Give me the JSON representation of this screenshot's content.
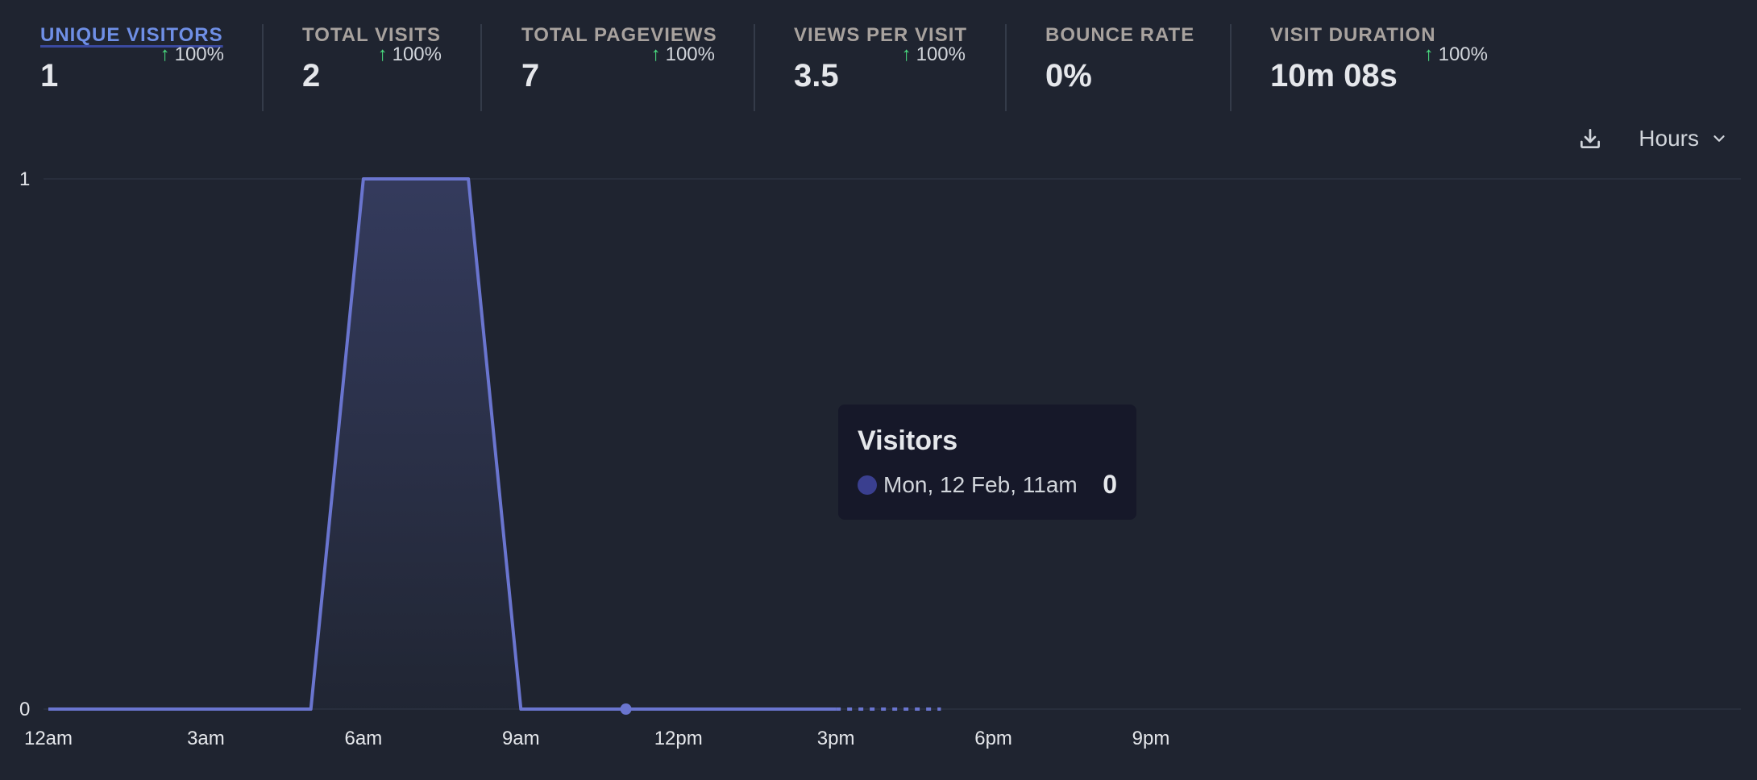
{
  "stats": [
    {
      "label": "UNIQUE VISITORS",
      "value": "1",
      "change": "100%",
      "active": true
    },
    {
      "label": "TOTAL VISITS",
      "value": "2",
      "change": "100%",
      "active": false
    },
    {
      "label": "TOTAL PAGEVIEWS",
      "value": "7",
      "change": "100%",
      "active": false
    },
    {
      "label": "VIEWS PER VISIT",
      "value": "3.5",
      "change": "100%",
      "active": false
    },
    {
      "label": "BOUNCE RATE",
      "value": "0%",
      "change": "",
      "active": false
    },
    {
      "label": "VISIT DURATION",
      "value": "10m 08s",
      "change": "100%",
      "active": false
    }
  ],
  "icons": {
    "change_up": "arrow-up-icon",
    "download": "download-icon",
    "interval_chevron": "chevron-down-icon"
  },
  "toolbar": {
    "interval_label": "Hours"
  },
  "tooltip": {
    "title": "Visitors",
    "date": "Mon, 12 Feb, 11am",
    "value": "0"
  },
  "colors": {
    "line": "#6a75cf",
    "accent": "#6f8fe6",
    "positive": "#4ade80",
    "background": "#1f2430"
  },
  "chart_data": {
    "type": "area",
    "x": [
      "12am",
      "1am",
      "2am",
      "3am",
      "4am",
      "5am",
      "6am",
      "7am",
      "8am",
      "9am",
      "10am",
      "11am",
      "12pm",
      "1pm",
      "2pm",
      "3pm",
      "4pm",
      "5pm"
    ],
    "series": [
      {
        "values": [
          0,
          0,
          0,
          0,
          0,
          0,
          1,
          1,
          1,
          0,
          0,
          0,
          0,
          0,
          0,
          0,
          0,
          0
        ],
        "dashed_from_index": 16
      }
    ],
    "x_tick_labels": [
      "12am",
      "3am",
      "6am",
      "9am",
      "12pm",
      "3pm",
      "6pm",
      "9pm"
    ],
    "x_tick_hours": [
      0,
      3,
      6,
      9,
      12,
      15,
      18,
      21
    ],
    "y_tick_labels": [
      "0",
      "1"
    ],
    "ylim": [
      0,
      1
    ],
    "x_hours_range": [
      0,
      23
    ],
    "highlight_hour": 11
  }
}
